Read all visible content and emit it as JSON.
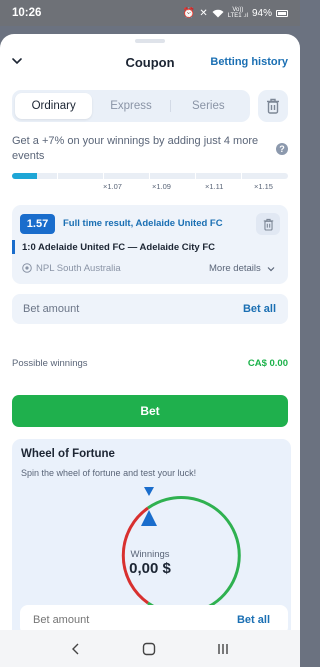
{
  "status": {
    "time": "10:26",
    "net_top": "Vo))",
    "net_bottom": "LTE1 .ıl",
    "battery": "94%"
  },
  "header": {
    "title": "Coupon",
    "history_link": "Betting history"
  },
  "tabs": [
    {
      "label": "Ordinary",
      "active": true
    },
    {
      "label": "Express",
      "active": false
    },
    {
      "label": "Series",
      "active": false
    }
  ],
  "promo": {
    "text": "Get a +7% on your winnings by adding just 4 more events",
    "progress_fraction": 0.09
  },
  "multipliers": [
    "×1.07",
    "×1.09",
    "×1.11",
    "×1.15"
  ],
  "event": {
    "odds": "1.57",
    "market": "Full time result, Adelaide United FC",
    "match": "1:0  Adelaide United FC — Adelaide City FC",
    "league": "NPL South Australia",
    "more_details": "More details"
  },
  "bet_amount": {
    "placeholder": "Bet amount",
    "bet_all": "Bet all"
  },
  "possible_winnings": {
    "label": "Possible winnings",
    "value": "CA$ 0.00"
  },
  "bet_button": "Bet",
  "wheel": {
    "title": "Wheel of Fortune",
    "subtitle": "Spin the wheel of fortune and test your luck!",
    "winnings_label": "Winnings",
    "winnings_value": "0,00 $",
    "bet_amount_placeholder": "Bet amount",
    "bet_all": "Bet all"
  },
  "colors": {
    "accent_blue": "#1a6dcc",
    "link": "#1a6fb3",
    "green": "#1fb04d",
    "red": "#d8302f"
  }
}
